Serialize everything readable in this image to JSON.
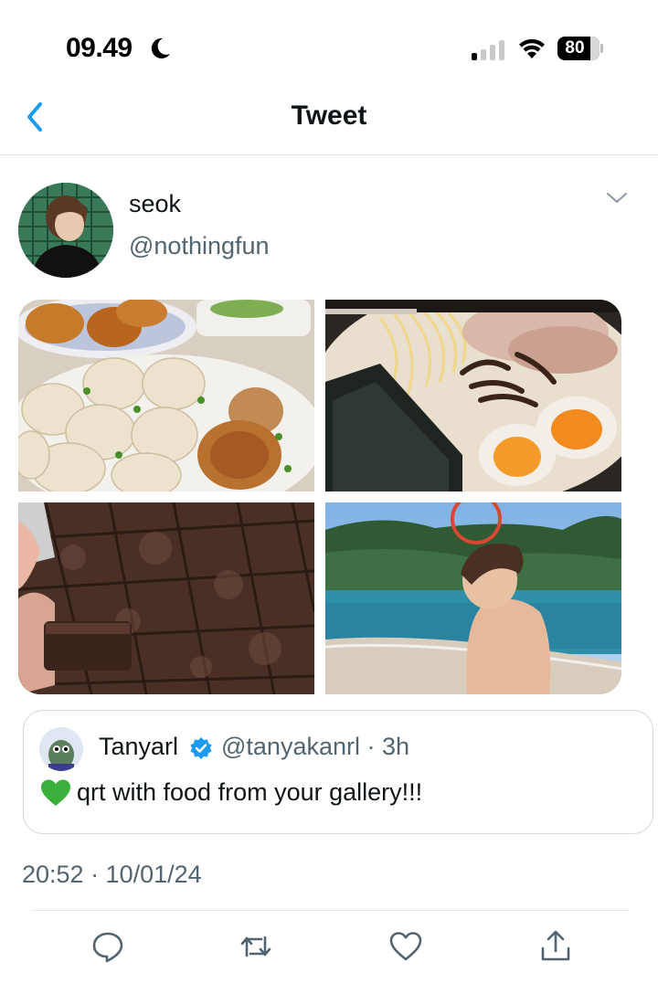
{
  "status_bar": {
    "time": "09.49",
    "battery": "80",
    "icons": [
      "moon-icon",
      "signal-icon",
      "wifi-icon",
      "battery-icon"
    ]
  },
  "header": {
    "title": "Tweet",
    "back_icon": "chevron-left-icon"
  },
  "tweet": {
    "author_name": "seok",
    "author_handle": "@nothingfun",
    "more_icon": "chevron-down-icon",
    "media": [
      {
        "name": "dumplings-photo"
      },
      {
        "name": "ramen-photo"
      },
      {
        "name": "brownies-photo"
      },
      {
        "name": "beach-photo"
      }
    ],
    "timestamp": "20:52 · 10/01/24"
  },
  "quote": {
    "name": "Tanyarl",
    "handle": "@tanyakanrl · 3h",
    "text": "qrt with food from your gallery!!!",
    "verified_icon": "verified-badge-icon",
    "emoji_icon": "green-heart-icon"
  },
  "actions": [
    {
      "name": "reply-button",
      "icon": "comment-icon"
    },
    {
      "name": "retweet-button",
      "icon": "retweet-icon"
    },
    {
      "name": "like-button",
      "icon": "heart-icon"
    },
    {
      "name": "share-button",
      "icon": "share-icon"
    }
  ],
  "colors": {
    "accent": "#1d9bf0",
    "text": "#0f1419",
    "secondary": "#536471",
    "border": "#cfd9de"
  }
}
